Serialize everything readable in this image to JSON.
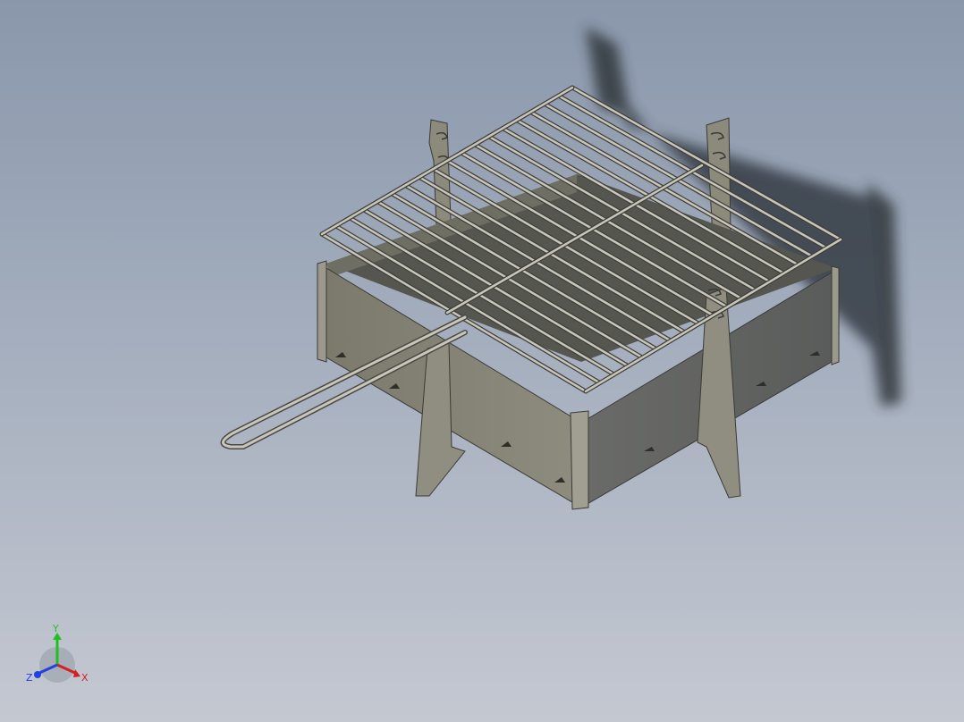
{
  "viewport": {
    "background_top": "#8a97ab",
    "background_bottom": "#c4c8d1"
  },
  "model": {
    "name": "grill-assembly",
    "grate_color": "#b3b0a4",
    "sheet_metal_color": "#878677",
    "sheet_metal_dark": "#4b4c48",
    "shadow_color": "#2a3036"
  },
  "triad": {
    "x_label": "X",
    "y_label": "Y",
    "z_label": "Z",
    "x_color": "#d42020",
    "y_color": "#20c020",
    "z_color": "#2040e0"
  }
}
